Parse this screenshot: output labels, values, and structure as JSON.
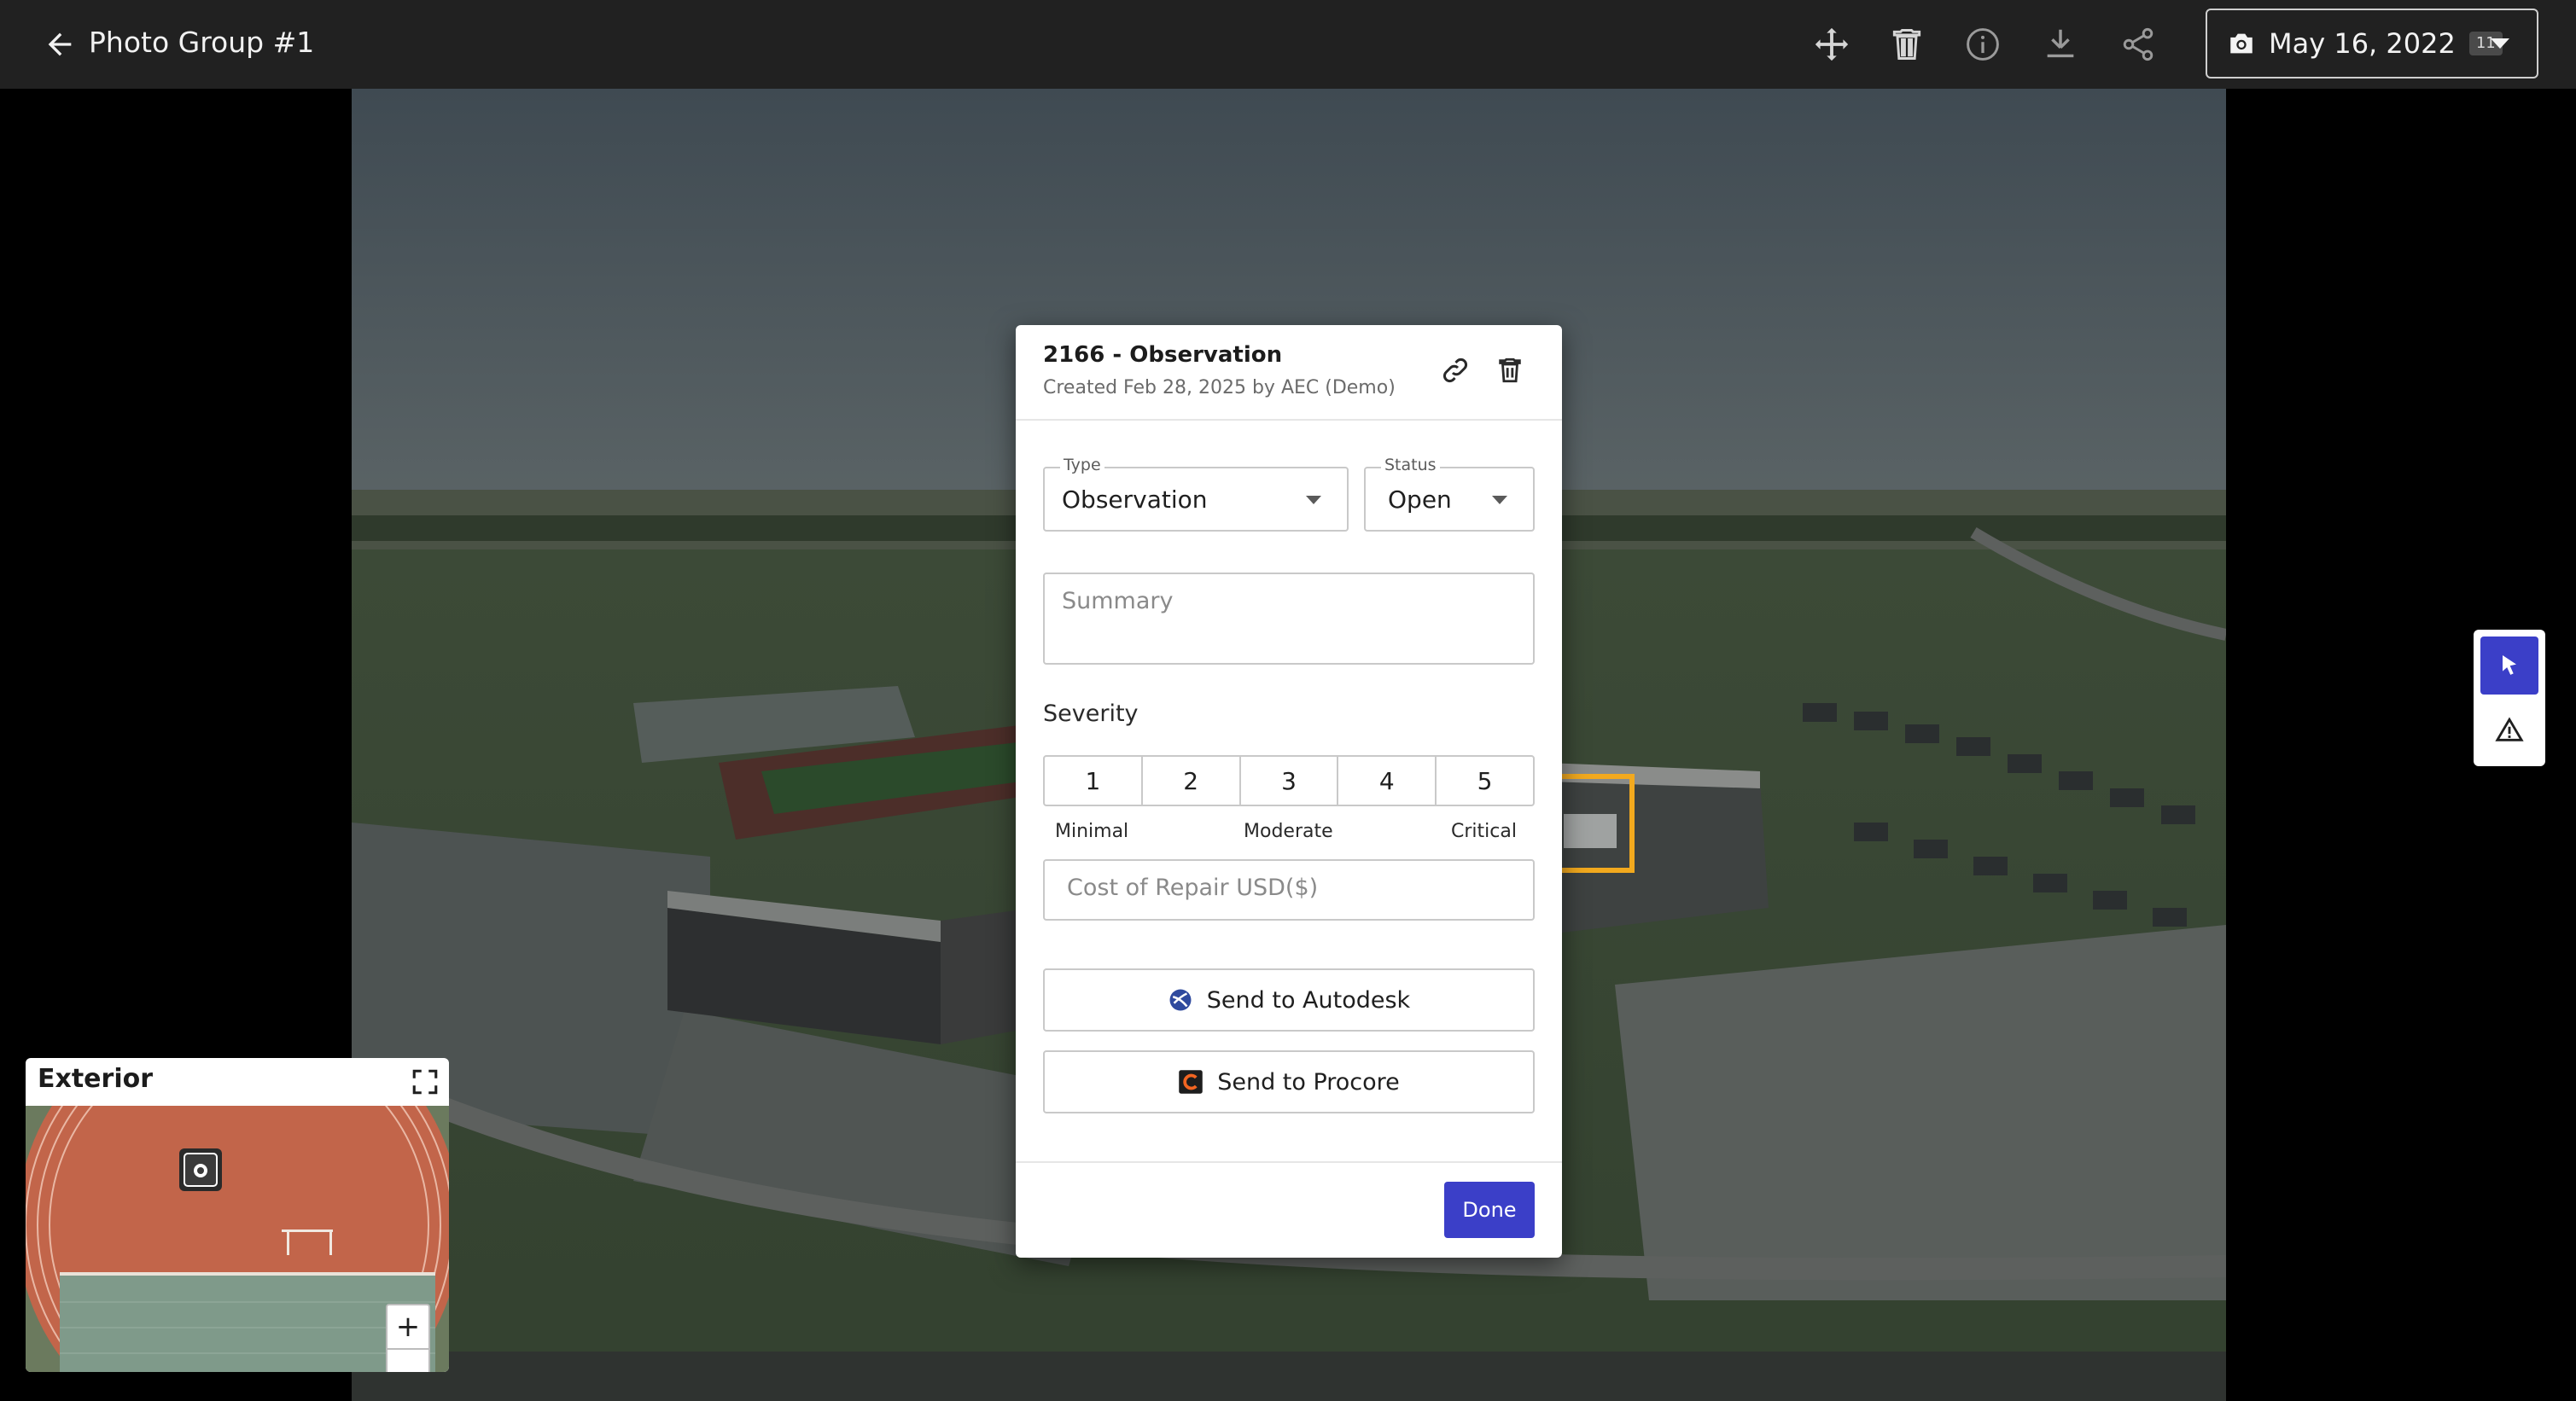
{
  "header": {
    "title": "Photo Group #1",
    "date_label": "May 16, 2022",
    "photo_count": "11",
    "tools": [
      "move-icon",
      "trash-icon",
      "info-icon",
      "download-icon",
      "share-icon"
    ]
  },
  "observation": {
    "title": "2166 - Observation",
    "subtitle": "Created Feb 28, 2025 by AEC (Demo)",
    "type_label": "Type",
    "type_value": "Observation",
    "status_label": "Status",
    "status_value": "Open",
    "summary_placeholder": "Summary",
    "severity_label": "Severity",
    "severity_levels": [
      "1",
      "2",
      "3",
      "4",
      "5"
    ],
    "severity_captions": {
      "low": "Minimal",
      "mid": "Moderate",
      "high": "Critical"
    },
    "cost_placeholder": "Cost of Repair USD($)",
    "autodesk_label": "Send to Autodesk",
    "procore_label": "Send to Procore",
    "done_label": "Done"
  },
  "minimap": {
    "title": "Exterior",
    "zoom_in": "+",
    "zoom_out": "−"
  },
  "colors": {
    "topbar": "#212121",
    "accent": "#3b3fc8",
    "highlight": "#f2a91e"
  }
}
